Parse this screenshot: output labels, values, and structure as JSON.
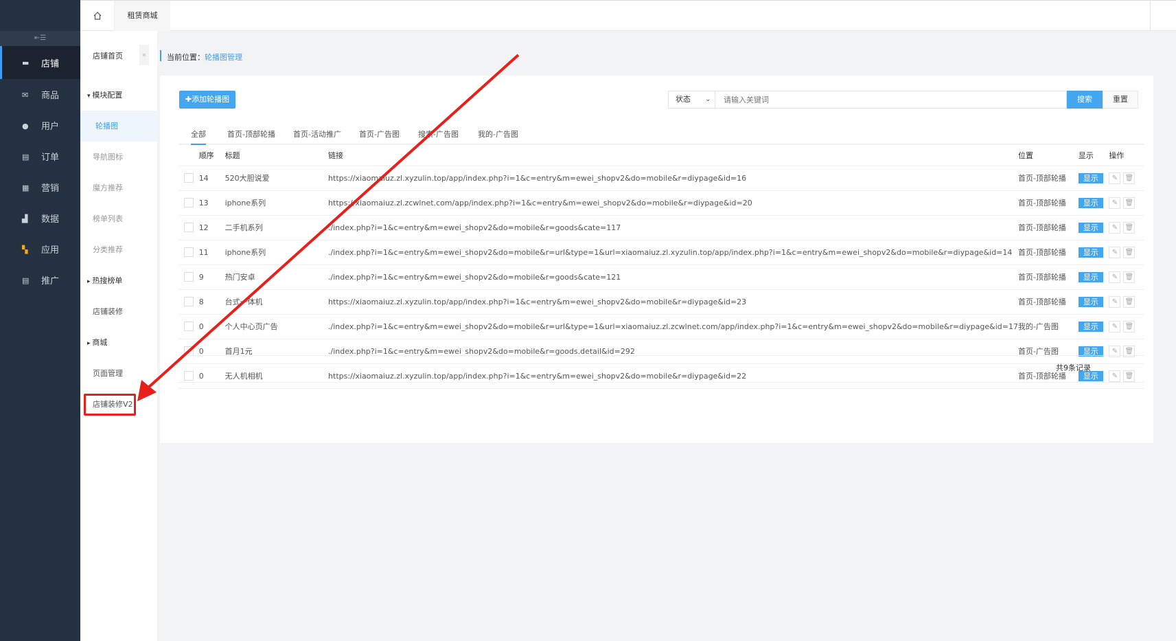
{
  "sidebar": {
    "items": [
      {
        "label": "店铺"
      },
      {
        "label": "商品"
      },
      {
        "label": "用户"
      },
      {
        "label": "订单"
      },
      {
        "label": "营销"
      },
      {
        "label": "数据"
      },
      {
        "label": "应用"
      },
      {
        "label": "推广"
      }
    ]
  },
  "topbar": {
    "tab": "租赁商城"
  },
  "subnav": {
    "home": "店铺首页",
    "items": [
      "模块配置",
      "轮播图",
      "导航图标",
      "魔方推荐",
      "榜单列表",
      "分类推荐",
      "热搜榜单",
      "店铺装修",
      "商城",
      "页面管理",
      "店铺装修V2"
    ]
  },
  "breadcrumb": {
    "prefix": "当前位置：",
    "current": "轮播图管理"
  },
  "toolbar": {
    "add": "添加轮播图",
    "status": "状态",
    "placeholder": "请输入关键词",
    "search": "搜索",
    "reset": "重置"
  },
  "tabs": [
    "全部",
    "首页-顶部轮播",
    "首页-活动推广",
    "首页-广告图",
    "搜索-广告图",
    "我的-广告图"
  ],
  "table": {
    "headers": [
      "顺序",
      "标题",
      "链接",
      "位置",
      "显示",
      "操作"
    ],
    "rows": [
      {
        "order": "14",
        "title": "520大胆说爱",
        "link": "https://xiaomaiuz.zl.xyzulin.top/app/index.php?i=1&c=entry&m=ewei_shopv2&do=mobile&r=diypage&id=16",
        "pos": "首页-顶部轮播",
        "show": "显示"
      },
      {
        "order": "13",
        "title": "iphone系列",
        "link": "https://xiaomaiuz.zl.zcwlnet.com/app/index.php?i=1&c=entry&m=ewei_shopv2&do=mobile&r=diypage&id=20",
        "pos": "首页-顶部轮播",
        "show": "显示"
      },
      {
        "order": "12",
        "title": "二手机系列",
        "link": "./index.php?i=1&c=entry&m=ewei_shopv2&do=mobile&r=goods&cate=117",
        "pos": "首页-顶部轮播",
        "show": "显示"
      },
      {
        "order": "11",
        "title": "iphone系列",
        "link": "./index.php?i=1&c=entry&m=ewei_shopv2&do=mobile&r=url&type=1&url=xiaomaiuz.zl.xyzulin.top/app/index.php?i=1&c=entry&m=ewei_shopv2&do=mobile&r=diypage&id=14",
        "pos": "首页-顶部轮播",
        "show": "显示"
      },
      {
        "order": "9",
        "title": "热门安卓",
        "link": "./index.php?i=1&c=entry&m=ewei_shopv2&do=mobile&r=goods&cate=121",
        "pos": "首页-顶部轮播",
        "show": "显示"
      },
      {
        "order": "8",
        "title": "台式一体机",
        "link": "https://xiaomaiuz.zl.xyzulin.top/app/index.php?i=1&c=entry&m=ewei_shopv2&do=mobile&r=diypage&id=23",
        "pos": "首页-顶部轮播",
        "show": "显示"
      },
      {
        "order": "0",
        "title": "个人中心页广告",
        "link": "./index.php?i=1&c=entry&m=ewei_shopv2&do=mobile&r=url&type=1&url=xiaomaiuz.zl.zcwlnet.com/app/index.php?i=1&c=entry&m=ewei_shopv2&do=mobile&r=diypage&id=17",
        "pos": "我的-广告图",
        "show": "显示"
      },
      {
        "order": "0",
        "title": "首月1元",
        "link": "./index.php?i=1&c=entry&m=ewei_shopv2&do=mobile&r=goods.detail&id=292",
        "pos": "首页-广告图",
        "show": "显示"
      },
      {
        "order": "0",
        "title": "无人机相机",
        "link": "https://xiaomaiuz.zl.xyzulin.top/app/index.php?i=1&c=entry&m=ewei_shopv2&do=mobile&r=diypage&id=22",
        "pos": "首页-顶部轮播",
        "show": "显示"
      }
    ]
  },
  "footer": "共9条记录",
  "colors": {
    "accent": "#44a6ee",
    "sidebar": "#243140",
    "annotation": "#e8201c"
  }
}
